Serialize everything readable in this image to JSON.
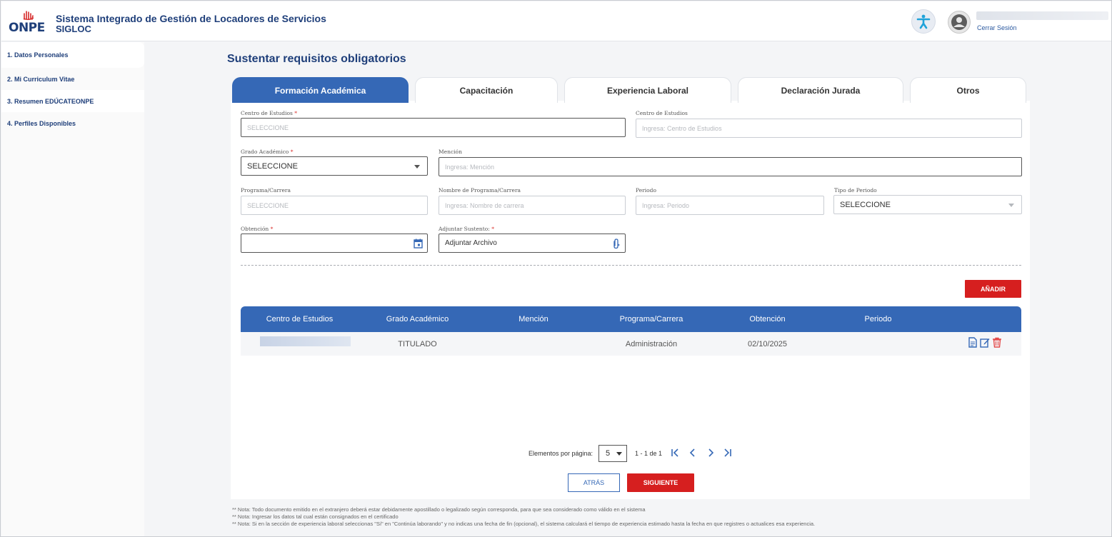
{
  "header": {
    "logo_text": "ONPE",
    "title": "Sistema Integrado de Gestión de Locadores de Servicios",
    "subtitle": "SIGLOC",
    "logout": "Cerrar Sesión"
  },
  "sidebar": {
    "items": [
      {
        "label": "1. Datos Personales"
      },
      {
        "label": "2. Mi Curriculum Vitae"
      },
      {
        "label": "3. Resumen EDÚCATEONPE"
      },
      {
        "label": "4. Perfiles Disponibles"
      }
    ]
  },
  "main": {
    "title": "Sustentar requisitos obligatorios",
    "tabs": [
      {
        "label": "Formación Académica",
        "active": true
      },
      {
        "label": "Capacitación"
      },
      {
        "label": "Experiencia Laboral"
      },
      {
        "label": "Declaración Jurada"
      },
      {
        "label": "Otros"
      }
    ]
  },
  "form": {
    "centro_estudios": {
      "label": "Centro de Estudios",
      "required": "*",
      "value": "SELECCIONE"
    },
    "centro_estudios_text": {
      "label": "Centro de Estudios",
      "placeholder": "Ingresa: Centro de Estudios"
    },
    "grado": {
      "label": "Grado Académico",
      "required": "*",
      "value": "SELECCIONE"
    },
    "mencion": {
      "label": "Mención",
      "placeholder": "Ingresa: Mención"
    },
    "programa": {
      "label": "Programa/Carrera",
      "value": "SELECCIONE"
    },
    "nombre_programa": {
      "label": "Nombre de Programa/Carrera",
      "placeholder": "Ingresa: Nombre de carrera"
    },
    "periodo": {
      "label": "Periodo",
      "placeholder": "Ingresa: Periodo"
    },
    "tipo_periodo": {
      "label": "Tipo de Periodo",
      "value": "SELECCIONE"
    },
    "obtencion": {
      "label": "Obtención",
      "required": "*",
      "value": ""
    },
    "adjuntar": {
      "label": "Adjuntar Sustento:",
      "required": "*",
      "value": "Adjuntar Archivo"
    },
    "add_button": "AÑADIR"
  },
  "table": {
    "columns": [
      "Centro de Estudios",
      "Grado Académico",
      "Mención",
      "Programa/Carrera",
      "Obtención",
      "Periodo"
    ],
    "rows": [
      {
        "centro": "",
        "grado": "TITULADO",
        "mencion": "",
        "programa": "Administración",
        "obtencion": "02/10/2025",
        "periodo": ""
      }
    ]
  },
  "pagination": {
    "label": "Elementos por página:",
    "page_size": "5",
    "range": "1 - 1 de 1"
  },
  "actions": {
    "back": "ATRÁS",
    "next": "SIGUIENTE"
  },
  "notes": [
    "** Nota: Todo documento emitido en el extranjero deberá estar debidamente apostillado o legalizado según corresponda, para que sea considerado como válido en el sistema",
    "** Nota: Ingresar los datos tal cual están consignados en el certificado",
    "** Nota: Si en la sección de experiencia laboral seleccionas \"Sí\" en \"Continúa laborando\" y no indicas una fecha de fin (opcional), el sistema calculará el tiempo de experiencia estimado hasta la fecha en que registres o actualices esa experiencia."
  ],
  "colors": {
    "primary": "#3568b6",
    "danger": "#d61f1f",
    "brand": "#1f3f7a"
  }
}
